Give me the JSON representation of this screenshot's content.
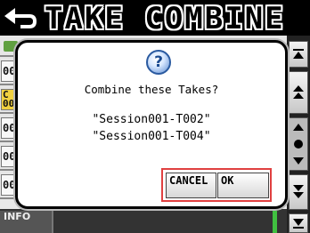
{
  "header": {
    "title": "TAKE COMBINE",
    "back_icon": "return-arrow-icon"
  },
  "list": {
    "rows": [
      {
        "num": "",
        "icon": "folder-icon"
      },
      {
        "num": "00",
        "icon": ""
      },
      {
        "num": "00",
        "icon": "",
        "selected": true,
        "prefix": "C"
      },
      {
        "num": "00",
        "icon": ""
      },
      {
        "num": "00",
        "icon": ""
      },
      {
        "num": "00",
        "icon": ""
      }
    ]
  },
  "bottom": {
    "info_label": "INFO"
  },
  "dialog": {
    "icon": "question-icon",
    "icon_glyph": "?",
    "message": "Combine these Takes?",
    "takes": [
      "\"Session001-T002\"",
      "\"Session001-T004\""
    ],
    "cancel_label": "CANCEL",
    "ok_label": "OK"
  },
  "colors": {
    "accent_border": "#e04040",
    "selected_row": "#f0d040",
    "meter_green": "#40c040"
  }
}
